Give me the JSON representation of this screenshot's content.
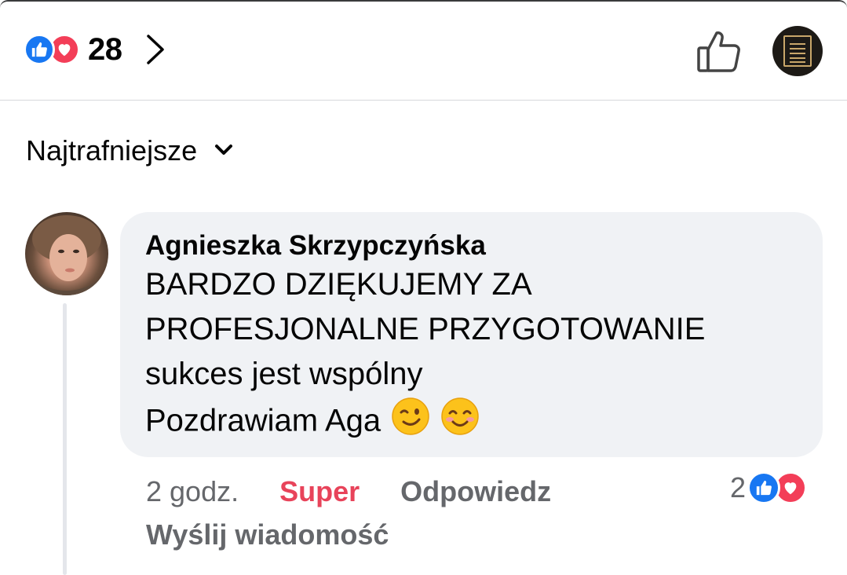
{
  "header": {
    "reaction_count": "28",
    "reactions": [
      "like-icon",
      "love-icon"
    ],
    "icons": [
      "chevron-right-icon",
      "thumbs-up-icon",
      "quiz-menu-icon"
    ]
  },
  "sort": {
    "label": "Najtrafniejsze",
    "icon": "chevron-down-icon"
  },
  "comment": {
    "author": "Agnieszka Skrzypczyńska",
    "lines": [
      "BARDZO DZIĘKUJEMY ZA",
      "PROFESJONALNE PRZYGOTOWANIE",
      "sukces jest wspólny",
      "Pozdrawiam Aga"
    ],
    "emojis": [
      "winking-face-emoji",
      "smiling-face-emoji"
    ],
    "time": "2 godz.",
    "reaction_label": "Super",
    "reply_label": "Odpowiedz",
    "message_label": "Wyślij wiadomość",
    "reaction_count": "2"
  },
  "colors": {
    "like_blue": "#1877f2",
    "love_red": "#f33e58",
    "super_label": "#e8435a",
    "bubble_bg": "#f0f2f5",
    "secondary_text": "#65676b"
  }
}
